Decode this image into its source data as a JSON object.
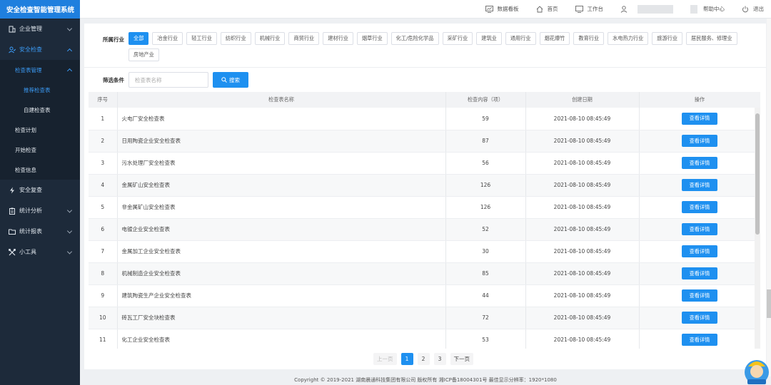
{
  "app": {
    "title": "安全检查智能管理系统"
  },
  "sidebar": {
    "items": [
      {
        "label": "企业管理"
      },
      {
        "label": "安全检查"
      },
      {
        "label": "安全复查"
      },
      {
        "label": "统计分析"
      },
      {
        "label": "统计报表"
      },
      {
        "label": "小工具"
      }
    ],
    "sub": {
      "checklist_mgmt": "检查表管理",
      "recommended": "推荐检查表",
      "custom": "自建检查表",
      "plan": "检查计划",
      "start": "开始检查",
      "info": "检查信息"
    }
  },
  "topbar": {
    "dashboard": "数据看板",
    "home": "首页",
    "workbench": "工作台",
    "help": "帮助中心",
    "logout": "退出"
  },
  "filters": {
    "industry_label": "所属行业",
    "tags": [
      "全部",
      "冶金行业",
      "轻工行业",
      "纺织行业",
      "机械行业",
      "商贸行业",
      "建材行业",
      "烟草行业",
      "化工/危险化学品",
      "采矿行业",
      "建筑业",
      "通用行业",
      "烟花爆竹",
      "教育行业",
      "水电热力行业",
      "旅游行业",
      "居民服务、修理业",
      "房地产业"
    ],
    "condition_label": "筛选条件",
    "search_placeholder": "检查表名称",
    "search_button": "搜索"
  },
  "table": {
    "headers": [
      "序号",
      "检查表名称",
      "检查内容（项）",
      "创建日期",
      "操作"
    ],
    "action_label": "查看详情",
    "rows": [
      {
        "no": "1",
        "name": "火电厂安全检查表",
        "count": "59",
        "date": "2021-08-10 08:45:49"
      },
      {
        "no": "2",
        "name": "日用陶瓷企业安全检查表",
        "count": "87",
        "date": "2021-08-10 08:45:49"
      },
      {
        "no": "3",
        "name": "污水处理厂安全检查表",
        "count": "56",
        "date": "2021-08-10 08:45:49"
      },
      {
        "no": "4",
        "name": "金属矿山安全检查表",
        "count": "126",
        "date": "2021-08-10 08:45:49"
      },
      {
        "no": "5",
        "name": "非金属矿山安全检查表",
        "count": "126",
        "date": "2021-08-10 08:45:49"
      },
      {
        "no": "6",
        "name": "电镀企业安全检查表",
        "count": "52",
        "date": "2021-08-10 08:45:49"
      },
      {
        "no": "7",
        "name": "金属加工企业安全检查表",
        "count": "30",
        "date": "2021-08-10 08:45:49"
      },
      {
        "no": "8",
        "name": "机械制造企业安全检查表",
        "count": "85",
        "date": "2021-08-10 08:45:49"
      },
      {
        "no": "9",
        "name": "建筑陶瓷生产企业安全检查表",
        "count": "44",
        "date": "2021-08-10 08:45:49"
      },
      {
        "no": "10",
        "name": "砖瓦工厂安全块检查表",
        "count": "72",
        "date": "2021-08-10 08:45:49"
      },
      {
        "no": "11",
        "name": "化工企业安全检查表",
        "count": "53",
        "date": "2021-08-10 08:45:49"
      }
    ]
  },
  "pager": {
    "prev": "上一页",
    "pages": [
      "1",
      "2",
      "3"
    ],
    "current": "1",
    "next": "下一页"
  },
  "footer": "Copyright © 2019-2021 湖南晨通科技集团有限公司 版权所有 湘ICP备18004301号 最佳显示分辨率：1920*1080",
  "colors": {
    "primary": "#1e90f0",
    "sidebar_bg": "#1d2a3a",
    "brand_bg": "#1f7fde"
  }
}
